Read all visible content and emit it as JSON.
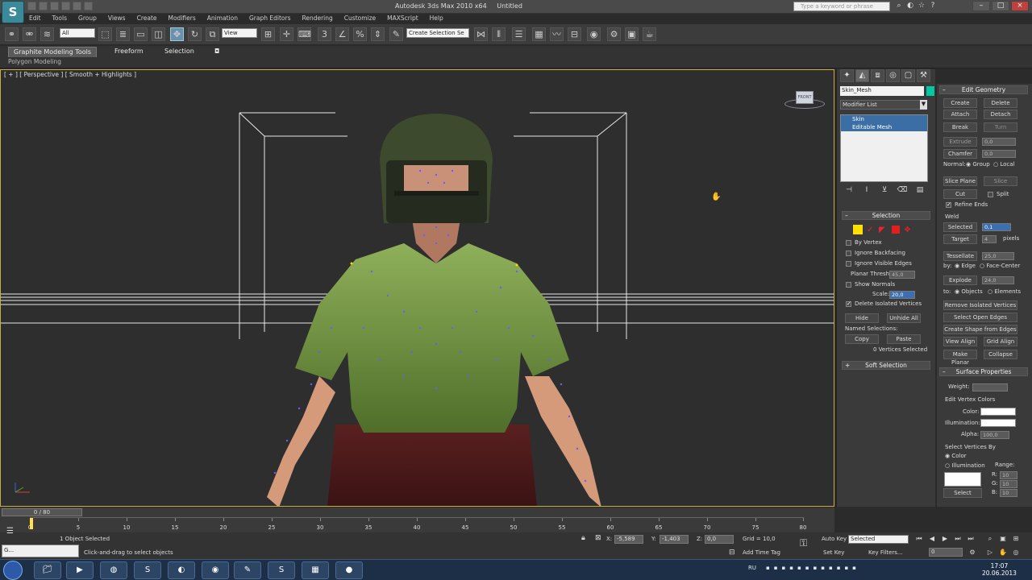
{
  "window": {
    "app_title": "Autodesk 3ds Max 2010 x64",
    "doc_title": "Untitled",
    "help_search_placeholder": "Type a keyword or phrase"
  },
  "menu": [
    "Edit",
    "Tools",
    "Group",
    "Views",
    "Create",
    "Modifiers",
    "Animation",
    "Graph Editors",
    "Rendering",
    "Customize",
    "MAXScript",
    "Help"
  ],
  "toolbar": {
    "selection_filter": "All",
    "ref_coord": "View",
    "named_selection_set": "Create Selection Se"
  },
  "ribbon": {
    "tabs": [
      "Graphite Modeling Tools",
      "Freeform",
      "Selection"
    ],
    "sub_label": "Polygon Modeling"
  },
  "viewport": {
    "label": "[ + ] [ Perspective ] [ Smooth + Highlights ]",
    "viewcube_text": "FRONT"
  },
  "command_panel": {
    "object_name": "Skin_Mesh",
    "object_color": "#00c8a0",
    "modifier_list": "Modifier List",
    "stack": [
      "Skin",
      "Editable Mesh"
    ],
    "selection": {
      "header": "Selection",
      "by_vertex": "By Vertex",
      "ignore_backfacing": "Ignore Backfacing",
      "ignore_visible_edges": "Ignore Visible Edges",
      "planar_thresh_label": "Planar Thresh:",
      "planar_thresh_value": "45,0",
      "show_normals": "Show Normals",
      "scale_label": "Scale:",
      "scale_value": "20,0",
      "delete_isolated": "Delete Isolated Vertices",
      "hide": "Hide",
      "unhide_all": "Unhide All",
      "named_selections": "Named Selections:",
      "copy": "Copy",
      "paste": "Paste",
      "vertices_selected": "0 Vertices Selected"
    },
    "soft_selection": "Soft Selection"
  },
  "edit_geometry": {
    "header": "Edit Geometry",
    "create": "Create",
    "delete": "Delete",
    "attach": "Attach",
    "detach": "Detach",
    "break": "Break",
    "turn": "Turn",
    "extrude": "Extrude",
    "extrude_value": "0,0",
    "chamfer": "Chamfer",
    "chamfer_value": "0,0",
    "normal_label": "Normal:",
    "group": "Group",
    "local": "Local",
    "slice_plane": "Slice Plane",
    "slice": "Slice",
    "cut": "Cut",
    "split": "Split",
    "refine_ends": "Refine Ends",
    "weld_label": "Weld",
    "selected": "Selected",
    "selected_value": "0,1",
    "target": "Target",
    "target_value": "4",
    "pixels": "pixels",
    "tessellate": "Tessellate",
    "tessellate_value": "25,0",
    "by_label": "by:",
    "edge": "Edge",
    "face_center": "Face-Center",
    "explode": "Explode",
    "explode_value": "24,0",
    "to_label": "to:",
    "objects": "Objects",
    "elements": "Elements",
    "remove_isolated": "Remove Isolated Vertices",
    "select_open_edges": "Select Open Edges",
    "create_shape": "Create Shape from Edges",
    "view_align": "View Align",
    "grid_align": "Grid Align",
    "make_planar": "Make Planar",
    "collapse": "Collapse"
  },
  "surface_properties": {
    "header": "Surface Properties",
    "weight": "Weight:",
    "edit_vertex_colors": "Edit Vertex Colors",
    "color": "Color:",
    "illumination": "Illumination:",
    "alpha": "Alpha:",
    "alpha_value": "100,0",
    "select_vertices_by": "Select Vertices By",
    "color_opt": "Color",
    "illumination_opt": "Illumination",
    "range": "Range:",
    "r": "R:",
    "g": "G:",
    "b": "B:",
    "r_value": "10",
    "g_value": "10",
    "b_value": "10",
    "select": "Select"
  },
  "timeline": {
    "frame_range": "0 / 80",
    "ticks": [
      "0",
      "5",
      "10",
      "15",
      "20",
      "25",
      "30",
      "35",
      "40",
      "45",
      "50",
      "55",
      "60",
      "65",
      "70",
      "75",
      "80"
    ]
  },
  "status": {
    "selected_count": "1 Object Selected",
    "prompt": "Click-and-drag to select objects",
    "x_label": "X:",
    "x_value": "-5,589",
    "y_label": "Y:",
    "y_value": "-1,403",
    "z_label": "Z:",
    "z_value": "0,0",
    "grid": "Grid = 10,0",
    "auto_key": "Auto Key",
    "auto_key_mode": "Selected",
    "set_key": "Set Key",
    "key_filters": "Key Filters...",
    "add_time_tag": "Add Time Tag",
    "frame_value": "0",
    "mini_listener": "G..."
  },
  "taskbar": {
    "language": "RU",
    "time": "17:07",
    "date": "20.06.2013"
  }
}
